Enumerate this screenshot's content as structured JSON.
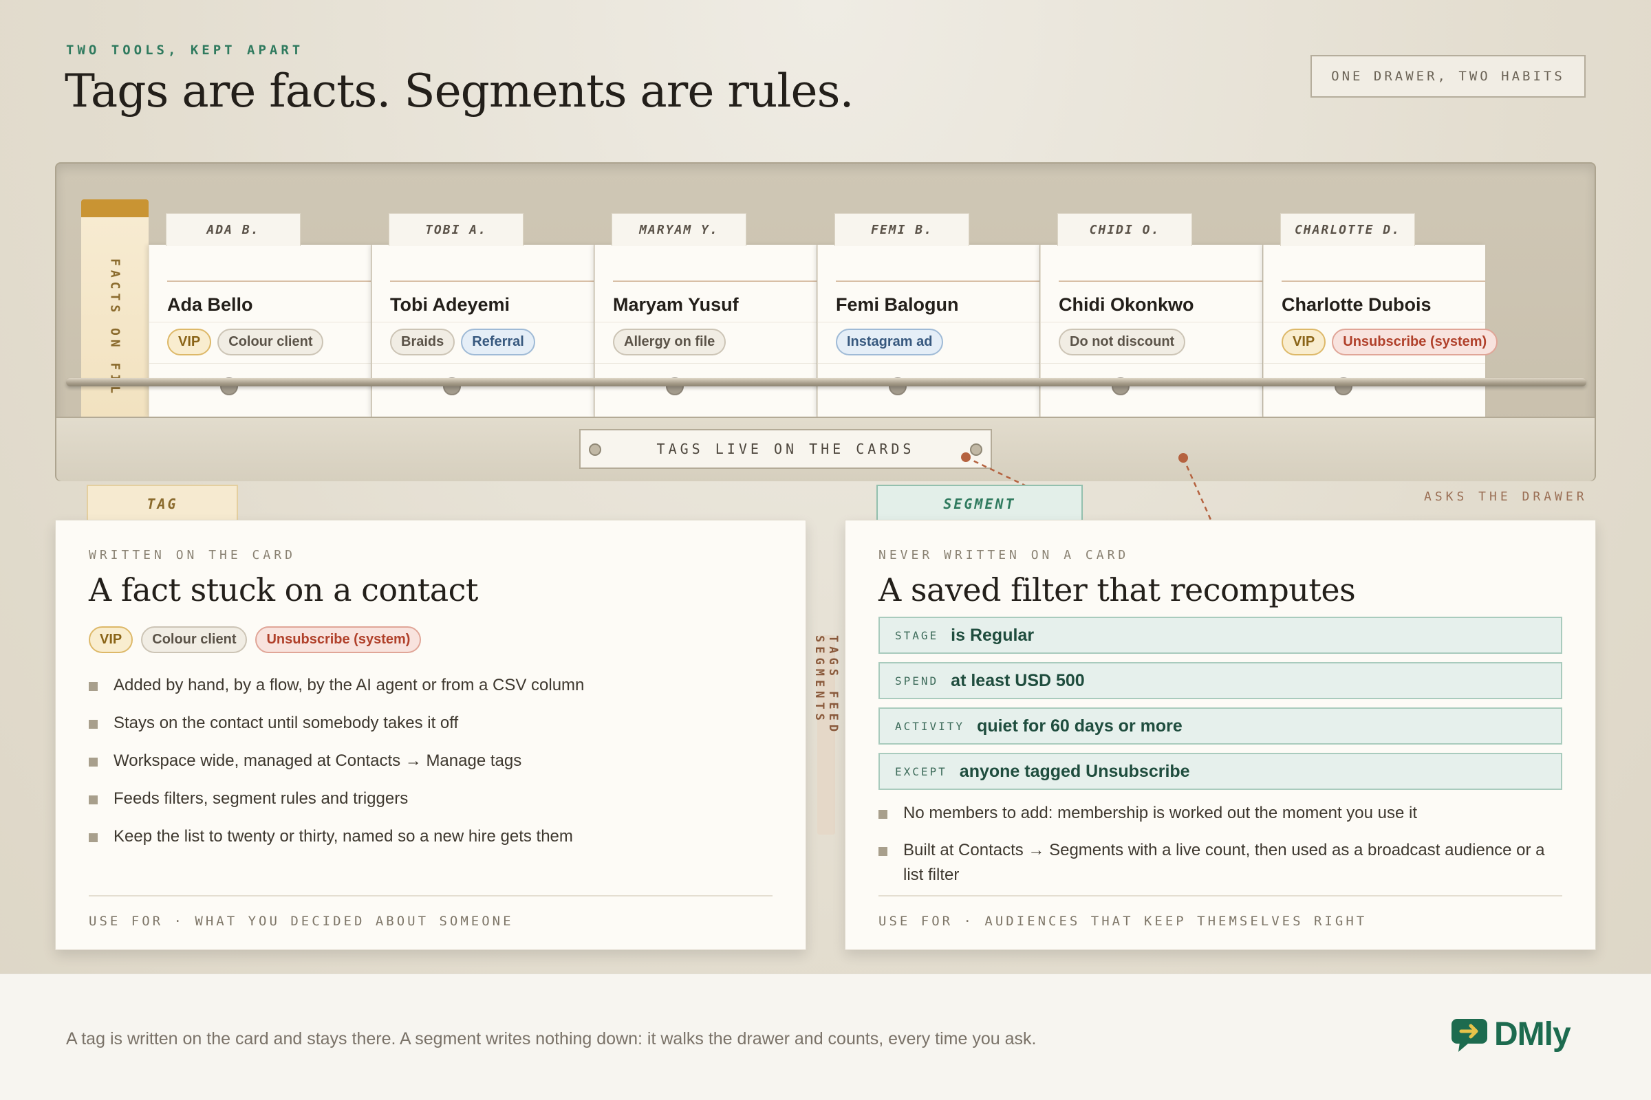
{
  "header": {
    "eyebrow": "TWO TOOLS, KEPT APART",
    "title": "Tags are facts. Segments are rules.",
    "badge": "ONE DRAWER, TWO HABITS"
  },
  "drawer": {
    "spine_label": "FACTS ON FILE",
    "front_label": "TAGS LIVE ON THE CARDS",
    "cards": [
      {
        "tab": "ADA B.",
        "name": "Ada Bello",
        "tags": [
          {
            "label": "VIP",
            "kind": "vip"
          },
          {
            "label": "Colour client",
            "kind": "plain"
          }
        ]
      },
      {
        "tab": "TOBI A.",
        "name": "Tobi Adeyemi",
        "tags": [
          {
            "label": "Braids",
            "kind": "plain"
          },
          {
            "label": "Referral",
            "kind": "blue"
          }
        ]
      },
      {
        "tab": "MARYAM Y.",
        "name": "Maryam Yusuf",
        "tags": [
          {
            "label": "Allergy on file",
            "kind": "plain"
          }
        ]
      },
      {
        "tab": "FEMI B.",
        "name": "Femi Balogun",
        "tags": [
          {
            "label": "Instagram ad",
            "kind": "blue"
          }
        ]
      },
      {
        "tab": "CHIDI O.",
        "name": "Chidi Okonkwo",
        "tags": [
          {
            "label": "Do not discount",
            "kind": "plain"
          }
        ]
      },
      {
        "tab": "CHARLOTTE D.",
        "name": "Charlotte Dubois",
        "tags": [
          {
            "label": "VIP",
            "kind": "vip"
          },
          {
            "label": "Unsubscribe (system)",
            "kind": "red"
          }
        ]
      }
    ]
  },
  "tag_panel": {
    "tab": "TAG",
    "eyebrow": "WRITTEN ON THE CARD",
    "title": "A fact stuck on a contact",
    "chips": [
      {
        "label": "VIP",
        "kind": "vip"
      },
      {
        "label": "Colour client",
        "kind": "plain"
      },
      {
        "label": "Unsubscribe (system)",
        "kind": "red"
      }
    ],
    "bullets": [
      "Added by hand, by a flow, by the AI agent or from a CSV column",
      "Stays on the contact until somebody takes it off",
      "Workspace wide, managed at Contacts → Manage tags",
      "Feeds filters, segment rules and triggers",
      "Keep the list to twenty or thirty, named so a new hire gets them"
    ],
    "footer": "USE FOR · WHAT YOU DECIDED ABOUT SOMEONE"
  },
  "segment_panel": {
    "tab": "SEGMENT",
    "eyebrow": "NEVER WRITTEN ON A CARD",
    "title": "A saved filter that recomputes",
    "rules": [
      {
        "key": "STAGE",
        "value": "is Regular"
      },
      {
        "key": "SPEND",
        "value": "at least USD 500"
      },
      {
        "key": "ACTIVITY",
        "value": "quiet for 60 days or more"
      },
      {
        "key": "EXCEPT",
        "value": "anyone tagged Unsubscribe"
      }
    ],
    "bullets": [
      "No members to add: membership is worked out the moment you use it",
      "Built at Contacts → Segments with a live count, then used as a broadcast audience or a list filter"
    ],
    "footer": "USE FOR · AUDIENCES THAT KEEP THEMSELVES RIGHT"
  },
  "connectors": {
    "feed_label": "TAGS FEED SEGMENTS",
    "asks_label": "ASKS THE DRAWER"
  },
  "footer": {
    "text": "A tag is written on the card and stays there. A segment writes nothing down: it walks the drawer and counts, every time you ask.",
    "logo": "DMly"
  },
  "colors": {
    "accent_green": "#2f7a5e",
    "tag_gold": "#c99433",
    "segment_mint": "#e6f0ec",
    "unsubscribe_red": "#b0402a",
    "connector_rust": "#b5623f"
  }
}
